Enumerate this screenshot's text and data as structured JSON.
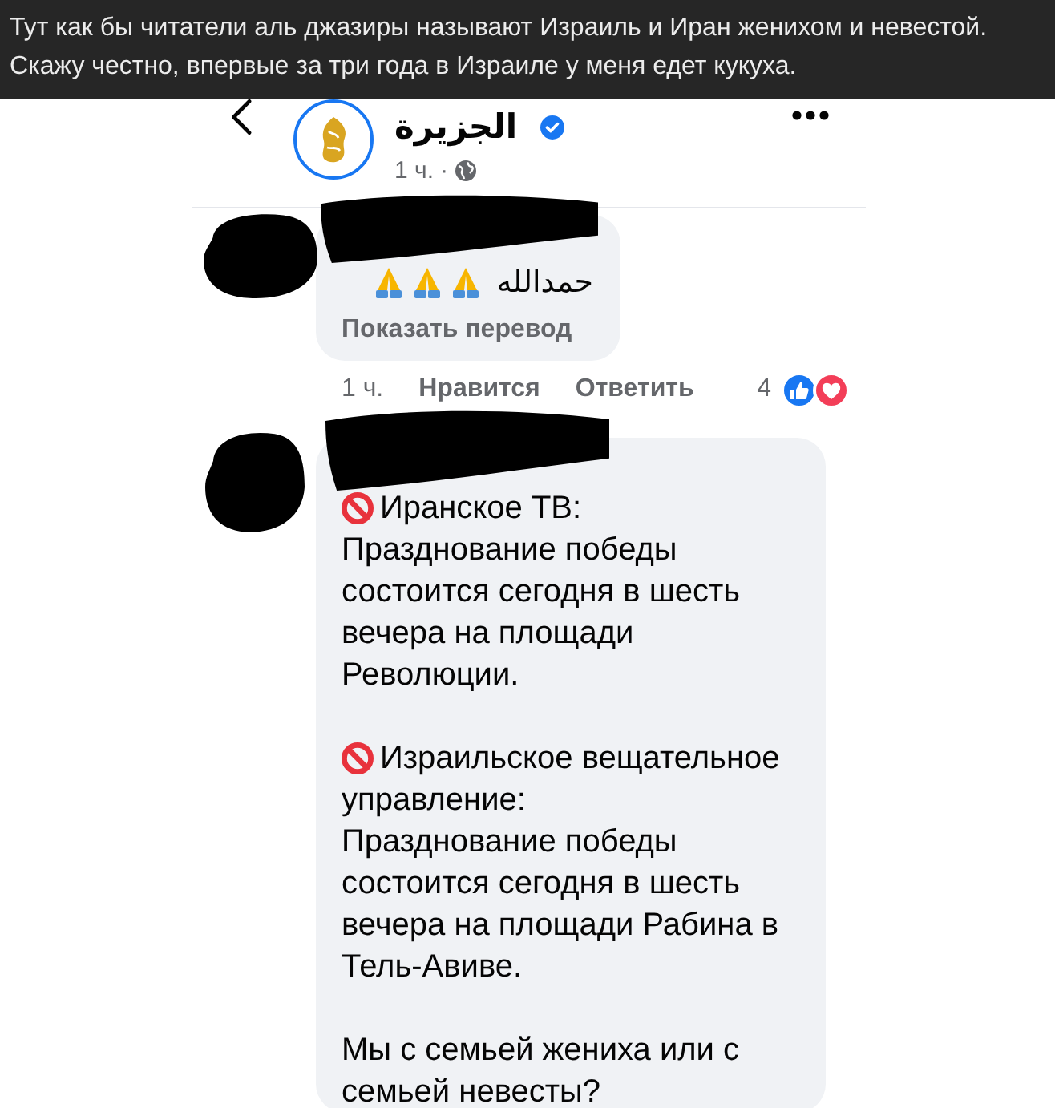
{
  "caption": {
    "text": "Тут как бы читатели аль джазиры называют Израиль и Иран женихом и невестой.\nСкажу честно, впервые за три года в Израиле у меня едет кукуха."
  },
  "post_header": {
    "channel_name": "الجزيرة",
    "verified": true,
    "time": "1 ч.",
    "separator": "·"
  },
  "comments": [
    {
      "kind": "short",
      "text": "حمدالله",
      "translate_link": "Показать перевод",
      "time": "1 ч.",
      "like_action": "Нравится",
      "reply_action": "Ответить",
      "reaction_count": "4"
    },
    {
      "kind": "long",
      "paragraphs": [
        {
          "kind": "flagged",
          "first_line": "Иранское ТВ:",
          "text": "Празднование победы\nсостоится сегодня в шесть\nвечера на площади\nРеволюции."
        },
        {
          "kind": "flagged",
          "first_line": "Израильское вещательное",
          "text": "управление:\nПразднование победы\nсостоится сегодня в шесть\nвечера на площади Рабина в\nТель-Авиве."
        },
        {
          "kind": "plain",
          "text": "Мы с семьей жениха или с\nсемьей невесты?"
        }
      ]
    }
  ]
}
